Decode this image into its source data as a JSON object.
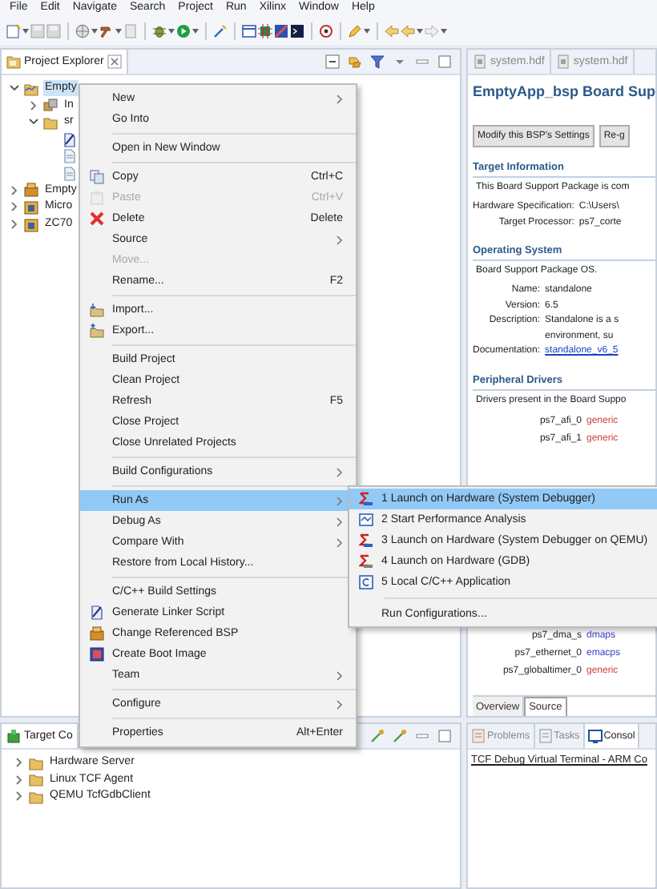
{
  "menu_bar": [
    "File",
    "Edit",
    "Navigate",
    "Search",
    "Project",
    "Run",
    "Xilinx",
    "Window",
    "Help"
  ],
  "project_explorer": {
    "title": "Project Explorer",
    "tree": [
      {
        "label": "Empty",
        "expanded": true,
        "selected": true,
        "children": [
          {
            "label": "In",
            "expanded": false,
            "selected": false
          },
          {
            "label": "sr",
            "expanded": true,
            "selected": false,
            "children": [
              {
                "selected": false
              },
              {
                "selected": false
              },
              {
                "selected": false
              }
            ]
          }
        ]
      },
      {
        "label": "Empty",
        "expanded": false,
        "selected": false
      },
      {
        "label": "Micro",
        "expanded": false,
        "selected": false
      },
      {
        "label": "ZC70",
        "expanded": false,
        "selected": false
      }
    ]
  },
  "context_menu": {
    "items": [
      {
        "kind": "item",
        "label": "New",
        "submenu": true,
        "disabled": false,
        "selected": false
      },
      {
        "kind": "item",
        "label": "Go Into",
        "submenu": false,
        "disabled": false,
        "selected": false
      },
      {
        "kind": "separator"
      },
      {
        "kind": "item",
        "label": "Open in New Window",
        "submenu": false,
        "disabled": false,
        "selected": false
      },
      {
        "kind": "separator"
      },
      {
        "kind": "item",
        "label": "Copy",
        "shortcut": "Ctrl+C",
        "submenu": false,
        "disabled": false,
        "selected": false
      },
      {
        "kind": "item",
        "label": "Paste",
        "shortcut": "Ctrl+V",
        "submenu": false,
        "disabled": true,
        "selected": false
      },
      {
        "kind": "item",
        "label": "Delete",
        "shortcut": "Delete",
        "submenu": false,
        "disabled": false,
        "selected": false
      },
      {
        "kind": "item",
        "label": "Source",
        "submenu": true,
        "disabled": false,
        "selected": false
      },
      {
        "kind": "item",
        "label": "Move...",
        "submenu": false,
        "disabled": true,
        "selected": false
      },
      {
        "kind": "item",
        "label": "Rename...",
        "shortcut": "F2",
        "submenu": false,
        "disabled": false,
        "selected": false
      },
      {
        "kind": "separator"
      },
      {
        "kind": "item",
        "label": "Import...",
        "submenu": false,
        "disabled": false,
        "selected": false
      },
      {
        "kind": "item",
        "label": "Export...",
        "submenu": false,
        "disabled": false,
        "selected": false
      },
      {
        "kind": "separator"
      },
      {
        "kind": "item",
        "label": "Build Project",
        "submenu": false,
        "disabled": false,
        "selected": false
      },
      {
        "kind": "item",
        "label": "Clean Project",
        "submenu": false,
        "disabled": false,
        "selected": false
      },
      {
        "kind": "item",
        "label": "Refresh",
        "shortcut": "F5",
        "submenu": false,
        "disabled": false,
        "selected": false
      },
      {
        "kind": "item",
        "label": "Close Project",
        "submenu": false,
        "disabled": false,
        "selected": false
      },
      {
        "kind": "item",
        "label": "Close Unrelated Projects",
        "submenu": false,
        "disabled": false,
        "selected": false
      },
      {
        "kind": "separator"
      },
      {
        "kind": "item",
        "label": "Build Configurations",
        "submenu": true,
        "disabled": false,
        "selected": false
      },
      {
        "kind": "separator"
      },
      {
        "kind": "item",
        "label": "Run As",
        "submenu": true,
        "disabled": false,
        "selected": true
      },
      {
        "kind": "item",
        "label": "Debug As",
        "submenu": true,
        "disabled": false,
        "selected": false
      },
      {
        "kind": "item",
        "label": "Compare With",
        "submenu": true,
        "disabled": false,
        "selected": false
      },
      {
        "kind": "item",
        "label": "Restore from Local History...",
        "submenu": false,
        "disabled": false,
        "selected": false
      },
      {
        "kind": "separator"
      },
      {
        "kind": "item",
        "label": "C/C++ Build Settings",
        "submenu": false,
        "disabled": false,
        "selected": false
      },
      {
        "kind": "item",
        "label": "Generate Linker Script",
        "submenu": false,
        "disabled": false,
        "selected": false
      },
      {
        "kind": "item",
        "label": "Change Referenced BSP",
        "submenu": false,
        "disabled": false,
        "selected": false
      },
      {
        "kind": "item",
        "label": "Create Boot Image",
        "submenu": false,
        "disabled": false,
        "selected": false
      },
      {
        "kind": "item",
        "label": "Team",
        "submenu": true,
        "disabled": false,
        "selected": false
      },
      {
        "kind": "separator"
      },
      {
        "kind": "item",
        "label": "Configure",
        "submenu": true,
        "disabled": false,
        "selected": false
      },
      {
        "kind": "separator"
      },
      {
        "kind": "item",
        "label": "Properties",
        "shortcut": "Alt+Enter",
        "submenu": false,
        "disabled": false,
        "selected": false
      }
    ]
  },
  "run_as_submenu": {
    "items": [
      {
        "kind": "item",
        "label": "1 Launch on Hardware (System Debugger)",
        "selected": true
      },
      {
        "kind": "item",
        "label": "2 Start Performance Analysis",
        "selected": false
      },
      {
        "kind": "item",
        "label": "3 Launch on Hardware (System Debugger on QEMU)",
        "selected": false
      },
      {
        "kind": "item",
        "label": "4 Launch on Hardware (GDB)",
        "selected": false
      },
      {
        "kind": "item",
        "label": "5 Local C/C++ Application",
        "selected": false
      },
      {
        "kind": "separator"
      },
      {
        "kind": "item",
        "label": "Run Configurations...",
        "selected": false
      }
    ]
  },
  "bsp_editor": {
    "tabs": [
      {
        "label": "system.hdf",
        "selected": false
      },
      {
        "label": "system.hdf",
        "selected": false
      }
    ],
    "title": "EmptyApp_bsp Board Sup",
    "buttons": [
      "Modify this BSP's Settings",
      "Re-g"
    ],
    "sections": [
      {
        "heading": "Target Information",
        "description": "This Board Support Package is com",
        "fields": [
          {
            "kind": "text",
            "name": "Hardware Specification:",
            "value": "C:\\Users\\"
          },
          {
            "kind": "text",
            "name": "Target Processor:",
            "value": "ps7_corte"
          }
        ]
      },
      {
        "heading": "Operating System",
        "description": "Board Support Package OS.",
        "fields": [
          {
            "kind": "text",
            "name": "Name:",
            "value": "standalone"
          },
          {
            "kind": "text",
            "name": "Version:",
            "value": "6.5"
          },
          {
            "kind": "text",
            "name": "Description:",
            "value": "Standalone is a s"
          },
          {
            "kind": "text",
            "value": "environment, su"
          },
          {
            "kind": "link",
            "name": "Documentation:",
            "value": "standalone_v6_5"
          }
        ]
      },
      {
        "heading": "Peripheral Drivers",
        "description": "Drivers present in the Board Suppo",
        "drivers": [
          {
            "name": "ps7_afi_0",
            "driver": "generic",
            "color": "#d03c3c"
          },
          {
            "name": "ps7_afi_1",
            "driver": "generic",
            "color": "#d03c3c"
          },
          {
            "name": "ps7_dma_s",
            "driver": "dmaps",
            "color": "#3c3cc8"
          },
          {
            "name": "ps7_ethernet_0",
            "driver": "emacps",
            "color": "#3c3cc8"
          },
          {
            "name": "ps7_globaltimer_0",
            "driver": "generic",
            "color": "#d03c3c"
          }
        ]
      }
    ],
    "bottom_tabs": [
      {
        "label": "Overview",
        "selected": false
      },
      {
        "label": "Source",
        "selected": true
      }
    ]
  },
  "target_connections": {
    "title": "Target Co",
    "tree": [
      {
        "label": "Hardware Server",
        "expanded": false
      },
      {
        "label": "Linux TCF Agent",
        "expanded": false
      },
      {
        "label": "QEMU TcfGdbClient",
        "expanded": false
      }
    ]
  },
  "console": {
    "tabs": [
      {
        "label": "Problems",
        "selected": false
      },
      {
        "label": "Tasks",
        "selected": false
      },
      {
        "label": "Consol",
        "selected": true
      }
    ],
    "lines": [
      "TCF Debug Virtual Terminal - ARM Co"
    ]
  }
}
